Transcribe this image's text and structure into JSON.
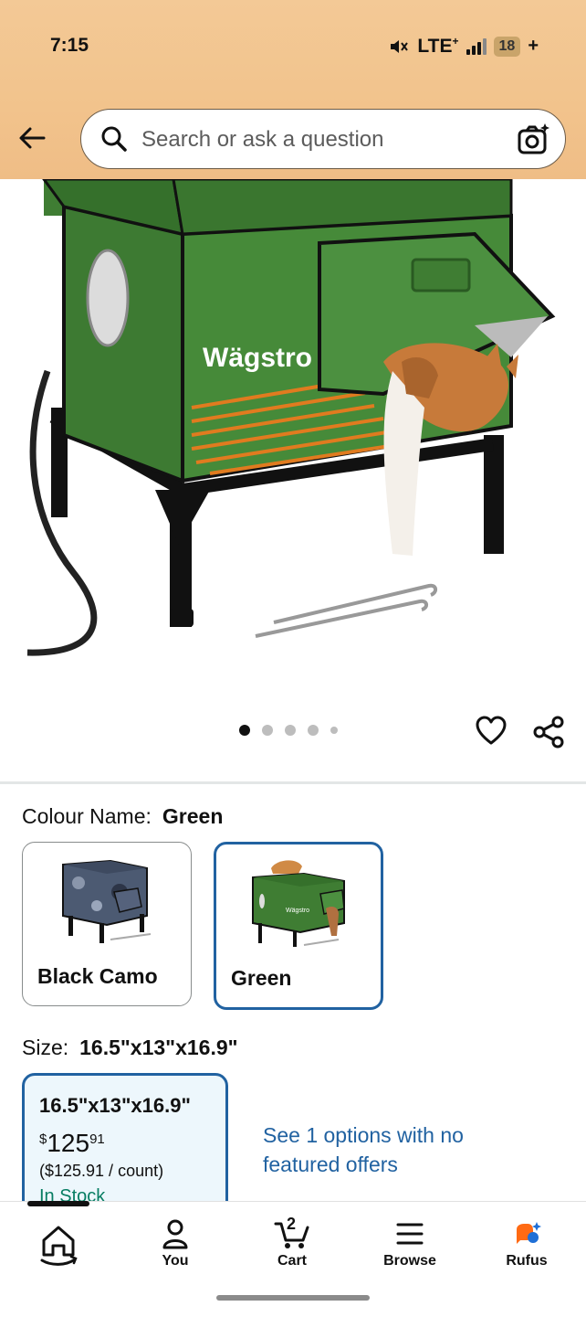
{
  "status_bar": {
    "time": "7:15",
    "network": "LTE",
    "network_sup": "+",
    "battery": "18",
    "battery_suffix": "+"
  },
  "search": {
    "placeholder": "Search or ask a question"
  },
  "product": {
    "brand_on_image": "Wägstro",
    "image_count": 5,
    "active_image_index": 0
  },
  "colour": {
    "label": "Colour Name:",
    "selected": "Green",
    "options": [
      {
        "label": "Black Camo",
        "selected": false
      },
      {
        "label": "Green",
        "selected": true
      }
    ]
  },
  "size": {
    "label": "Size:",
    "selected": "16.5\"x13\"x16.9\"",
    "card": {
      "title": "16.5\"x13\"x16.9\"",
      "currency": "$",
      "price_whole": "125",
      "price_fraction": "91",
      "unit_price": "($125.91 / count)",
      "stock": "In Stock"
    },
    "see_options": "See 1 options with no featured offers"
  },
  "bottom_nav": {
    "items": [
      {
        "label": "",
        "icon": "home-icon",
        "active": true
      },
      {
        "label": "You",
        "icon": "person-icon"
      },
      {
        "label": "Cart",
        "icon": "cart-icon",
        "count": "2"
      },
      {
        "label": "Browse",
        "icon": "menu-icon"
      },
      {
        "label": "Rufus",
        "icon": "rufus-icon"
      }
    ]
  },
  "colors": {
    "accent_blue": "#2162a1",
    "header_bg": "#f2c38c",
    "stock_green": "#067d62",
    "product_green": "#3d7a32"
  }
}
